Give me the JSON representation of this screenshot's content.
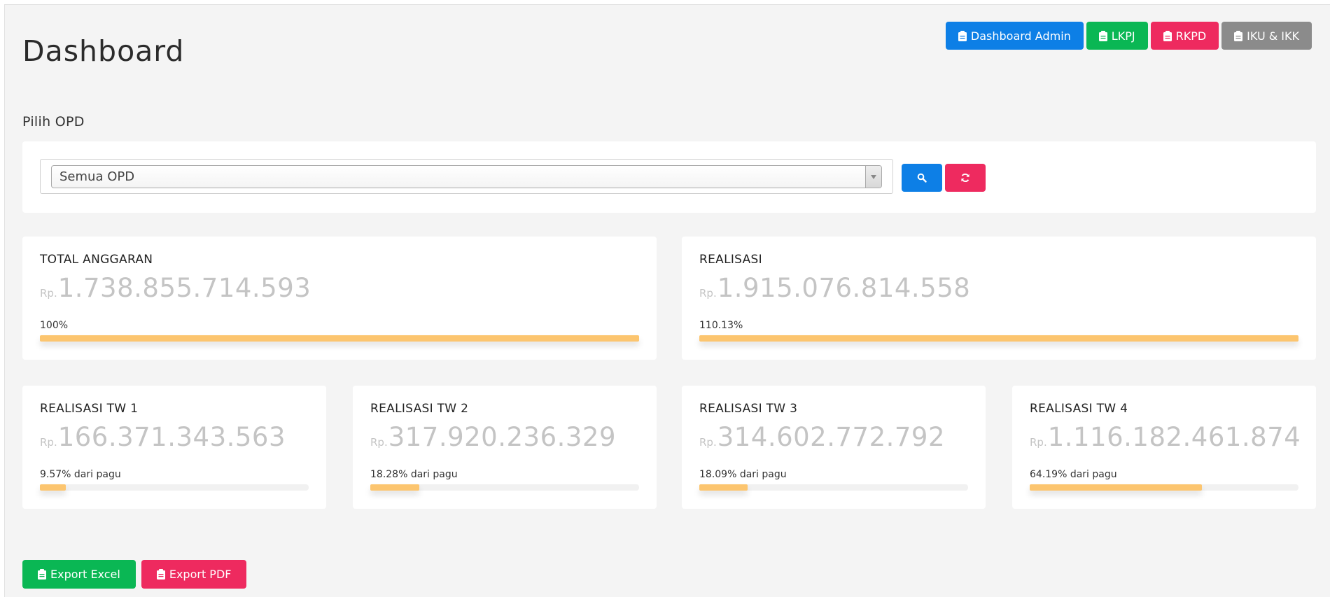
{
  "header": {
    "title": "Dashboard",
    "nav_buttons": [
      {
        "label": "Dashboard Admin",
        "color": "#0d7fe6",
        "icon": "clipboard-icon"
      },
      {
        "label": "LKPJ",
        "color": "#0ab754",
        "icon": "clipboard-icon"
      },
      {
        "label": "RKPD",
        "color": "#ee2a5f",
        "icon": "clipboard-icon"
      },
      {
        "label": "IKU & IKK",
        "color": "#8b8b8b",
        "icon": "clipboard-icon"
      }
    ]
  },
  "opd": {
    "label": "Pilih OPD",
    "selected": "Semua OPD",
    "search_icon": "search-icon",
    "reset_icon": "refresh-icon"
  },
  "summary": {
    "currency": "Rp.",
    "total": {
      "title": "TOTAL ANGGARAN",
      "amount": "1.738.855.714.593",
      "percent_label": "100%",
      "progress": 100
    },
    "realisasi": {
      "title": "REALISASI",
      "amount": "1.915.076.814.558",
      "percent_label": "110.13%",
      "progress": 100
    }
  },
  "quarters": [
    {
      "title": "REALISASI TW 1",
      "amount": "166.371.343.563",
      "percent_label": "9.57% dari pagu",
      "progress": 9.57
    },
    {
      "title": "REALISASI TW 2",
      "amount": "317.920.236.329",
      "percent_label": "18.28% dari pagu",
      "progress": 18.28
    },
    {
      "title": "REALISASI TW 3",
      "amount": "314.602.772.792",
      "percent_label": "18.09% dari pagu",
      "progress": 18.09
    },
    {
      "title": "REALISASI TW 4",
      "amount": "1.116.182.461.874",
      "percent_label": "64.19% dari pagu",
      "progress": 64.19
    }
  ],
  "export": {
    "excel_label": "Export Excel",
    "pdf_label": "Export PDF"
  },
  "colors": {
    "progress_fill": "#fcc56f",
    "page_bg": "#f4f4f4"
  }
}
